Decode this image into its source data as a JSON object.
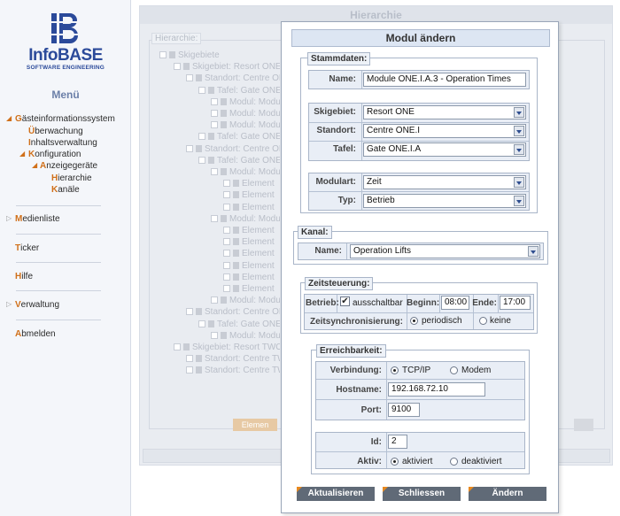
{
  "brand": {
    "name": "InfoBASE",
    "tagline": "SOFTWARE ENGINEERING",
    "accent": "#2b4a9a",
    "highlight": "#d0701a"
  },
  "sidebar": {
    "menu_title": "Menü",
    "items": {
      "gis": {
        "prefix": "G",
        "rest": "ästeinformationssystem"
      },
      "ueberwachung": {
        "prefix": "Ü",
        "rest": "berwachung"
      },
      "inhaltsverwaltung": {
        "prefix": "I",
        "rest": "nhaltsverwaltung"
      },
      "konfiguration": {
        "prefix": "K",
        "rest": "onfiguration"
      },
      "anzeigegeraete": {
        "prefix": "A",
        "rest": "nzeigegeräte"
      },
      "hierarchie": {
        "prefix": "H",
        "rest": "ierarchie"
      },
      "kanaele": {
        "prefix": "K",
        "rest": "anäle"
      },
      "medienliste": {
        "prefix": "M",
        "rest": "edienliste"
      },
      "ticker": {
        "prefix": "T",
        "rest": "icker"
      },
      "hilfe": {
        "prefix": "H",
        "rest": "ilfe"
      },
      "verwaltung": {
        "prefix": "V",
        "rest": "erwaltung"
      },
      "abmelden": {
        "prefix": "A",
        "rest": "bmelden"
      }
    }
  },
  "background": {
    "title": "Hierarchie",
    "field_label": "Hierarchie:",
    "button_label": "Elemen",
    "tree": [
      "Skigebiete",
      "Skigebiet: Resort ONE",
      "Standort: Centre ON",
      "Tafel: Gate ONE",
      "Modul: Modul",
      "Modul: Modul",
      "Modul: Modul",
      "Tafel: Gate ONE",
      "Standort: Centre ON",
      "Tafel: Gate ONE",
      "Modul: Modul",
      "Element",
      "Element",
      "Element",
      "Modul: Modul",
      "Element",
      "Element",
      "Element",
      "Element",
      "Element",
      "Element",
      "Modul: Modul",
      "Standort: Centre ON",
      "Tafel: Gate ONE",
      "Modul: Modul",
      "Skigebiet: Resort TWO",
      "Standort: Centre TW",
      "Standort: Centre TW"
    ]
  },
  "modal": {
    "title": "Modul ändern",
    "stammdaten": {
      "legend": "Stammdaten:",
      "name_label": "Name:",
      "name_value": "Module ONE.I.A.3 - Operation Times",
      "skigebiet_label": "Skigebiet:",
      "skigebiet_value": "Resort ONE",
      "standort_label": "Standort:",
      "standort_value": "Centre ONE.I",
      "tafel_label": "Tafel:",
      "tafel_value": "Gate ONE.I.A",
      "modulart_label": "Modulart:",
      "modulart_value": "Zeit",
      "typ_label": "Typ:",
      "typ_value": "Betrieb"
    },
    "kanal": {
      "legend": "Kanal:",
      "name_label": "Name:",
      "name_value": "Operation Lifts"
    },
    "zeitsteuerung": {
      "legend": "Zeitsteuerung:",
      "betrieb_label": "Betrieb:",
      "ausschaltbar_label": "ausschaltbar",
      "ausschaltbar_checked": true,
      "beginn_label": "Beginn:",
      "beginn_value": "08:00",
      "ende_label": "Ende:",
      "ende_value": "17:00",
      "sync_label": "Zeitsynchronisierung:",
      "opt_periodisch": "periodisch",
      "opt_keine": "keine",
      "sync_selected": "periodisch"
    },
    "erreichbarkeit": {
      "legend": "Erreichbarkeit:",
      "verbindung_label": "Verbindung:",
      "opt_tcpip": "TCP/IP",
      "opt_modem": "Modem",
      "verbindung_selected": "TCP/IP",
      "hostname_label": "Hostname:",
      "hostname_value": "192.168.72.10",
      "port_label": "Port:",
      "port_value": "9100",
      "id_label": "Id:",
      "id_value": "2",
      "aktiv_label": "Aktiv:",
      "opt_aktiviert": "aktiviert",
      "opt_deaktiviert": "deaktiviert",
      "aktiv_selected": "aktiviert"
    },
    "buttons": {
      "aktualisieren": "Aktualisieren",
      "schliessen": "Schliessen",
      "aendern": "Ändern"
    }
  }
}
